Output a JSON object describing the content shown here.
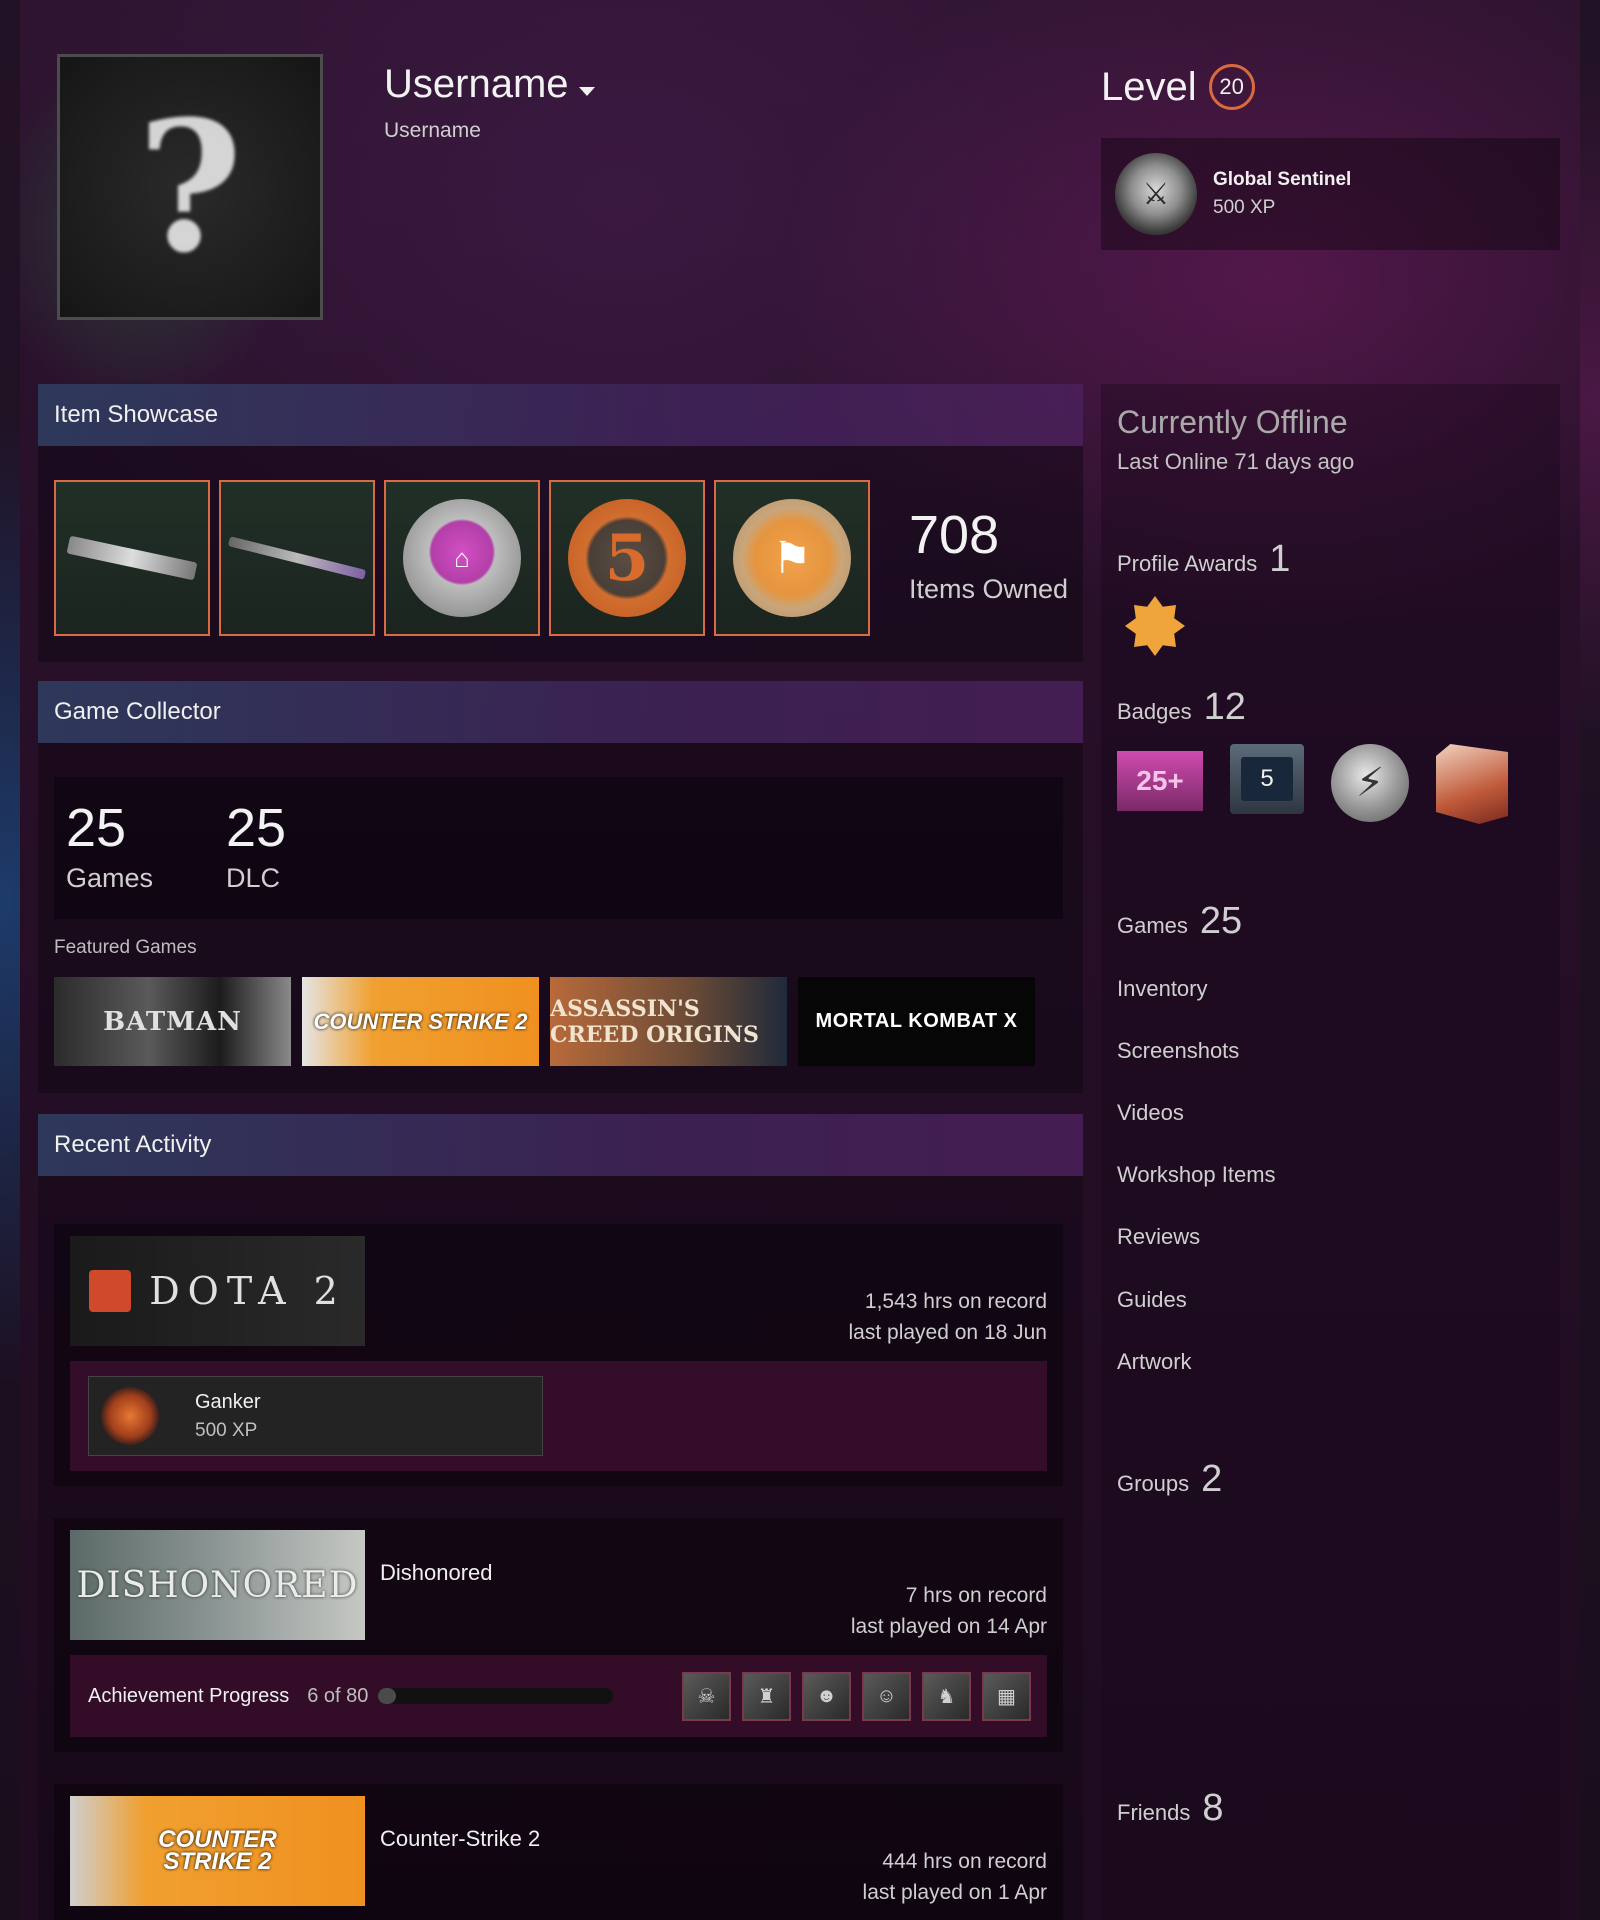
{
  "profile": {
    "persona_name": "Username",
    "real_name": "Username",
    "avatar_glyph": "?",
    "level_label": "Level",
    "level": "20",
    "featured_badge": {
      "name": "Global Sentinel",
      "xp": "500 XP",
      "icon": "cs-rank-emblem-icon"
    }
  },
  "showcase": {
    "title": "Item Showcase",
    "items": [
      {
        "name": "rifle-skin",
        "icon": "ak47-icon"
      },
      {
        "name": "sniper-skin",
        "icon": "awp-icon"
      },
      {
        "name": "capitol-coin",
        "icon": "coin-icon"
      },
      {
        "name": "veteran-coin",
        "icon": "coin-icon",
        "glyph": "5"
      },
      {
        "name": "service-medal",
        "icon": "medal-icon"
      }
    ],
    "items_owned": "708",
    "items_owned_label": "Items Owned"
  },
  "collector": {
    "title": "Game Collector",
    "games": "25",
    "games_label": "Games",
    "dlc": "25",
    "dlc_label": "DLC",
    "featured_label": "Featured Games",
    "featured": [
      {
        "label": "BATMAN"
      },
      {
        "label": "COUNTER STRIKE 2"
      },
      {
        "label": "ASSASSIN'S CREED ORIGINS"
      },
      {
        "label": "MORTAL KOMBAT X"
      }
    ]
  },
  "recent": {
    "title": "Recent Activity",
    "games": [
      {
        "capsule": "DOTA 2",
        "hours": "1,543 hrs on record",
        "last_played": "last played on 18 Jun",
        "badge": {
          "name": "Ganker",
          "xp": "500 XP"
        }
      },
      {
        "capsule": "DISHONORED",
        "title": "Dishonored",
        "hours": "7 hrs on record",
        "last_played": "last played on 14 Apr",
        "achievement_label": "Achievement Progress",
        "achievement_count": "6 of 80",
        "achievement_progress": 0.075
      },
      {
        "capsule_line1": "COUNTER",
        "capsule_line2": "STRIKE 2",
        "title": "Counter-Strike 2",
        "hours": "444 hrs on record",
        "last_played": "last played on 1 Apr"
      }
    ]
  },
  "sidebar": {
    "status": "Currently Offline",
    "last_online": "Last Online 71 days ago",
    "awards_label": "Profile Awards",
    "awards_count": "1",
    "badges_label": "Badges",
    "badges_count": "12",
    "badge_1": "25+",
    "badge_2": "5",
    "games_label": "Games",
    "games_count": "25",
    "links": [
      "Inventory",
      "Screenshots",
      "Videos",
      "Workshop Items",
      "Reviews",
      "Guides",
      "Artwork"
    ],
    "groups_label": "Groups",
    "groups_count": "2",
    "friends_label": "Friends",
    "friends_count": "8"
  },
  "colors": {
    "accent_orange": "#d96a3c",
    "showcase_border": "#d86a46",
    "page_bg": "#260f27"
  }
}
